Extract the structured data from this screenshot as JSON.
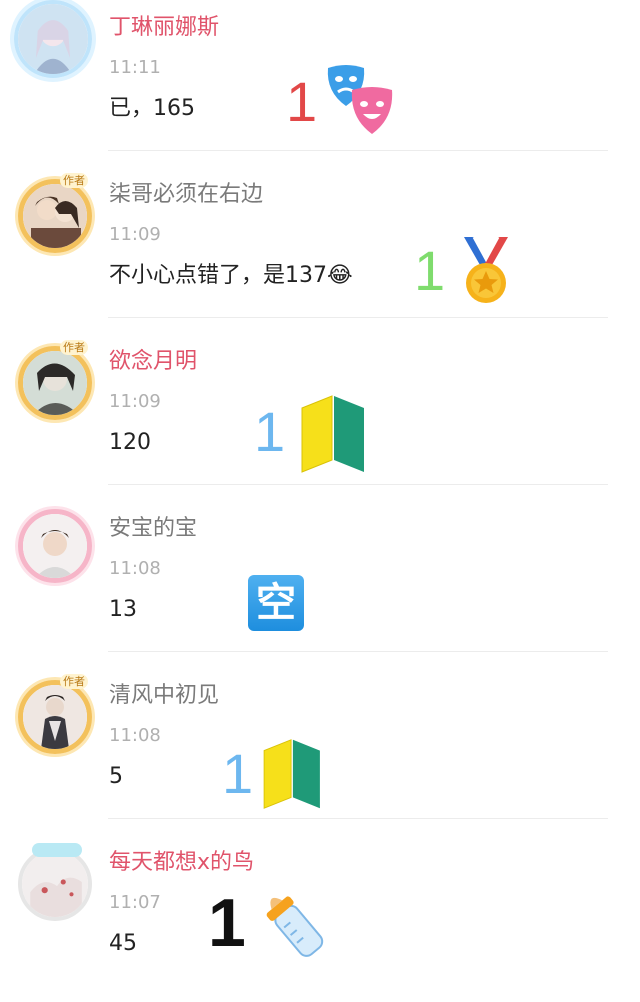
{
  "posts": [
    {
      "username": "丁琳丽娜斯",
      "time": "11:11",
      "message": "已，165",
      "overlay_number": "1",
      "overlay_color": "#e24848",
      "overlay_icon": "masks-icon"
    },
    {
      "username": "柒哥必须在右边",
      "time": "11:09",
      "message": "不小心点错了，是137😂",
      "overlay_number": "1",
      "overlay_color": "#7fdc6d",
      "overlay_icon": "medal-icon",
      "badge": "作者"
    },
    {
      "username": "欲念月明",
      "time": "11:09",
      "message": "120",
      "overlay_number": "1",
      "overlay_color": "#6db7ef",
      "overlay_icon": "beginner-icon",
      "badge": "作者"
    },
    {
      "username": "安宝的宝",
      "time": "11:08",
      "message": "13",
      "overlay_number": "",
      "overlay_color": "#1e8ede",
      "overlay_icon": "empty-sign-icon",
      "overlay_text": "空"
    },
    {
      "username": "清风中初见",
      "time": "11:08",
      "message": "5",
      "overlay_number": "1",
      "overlay_color": "#6db7ef",
      "overlay_icon": "beginner-icon",
      "badge": "作者"
    },
    {
      "username": "每天都想x的鸟",
      "time": "11:07",
      "message": "45",
      "overlay_number": "1",
      "overlay_color": "#111111",
      "overlay_icon": "baby-bottle-icon"
    }
  ]
}
